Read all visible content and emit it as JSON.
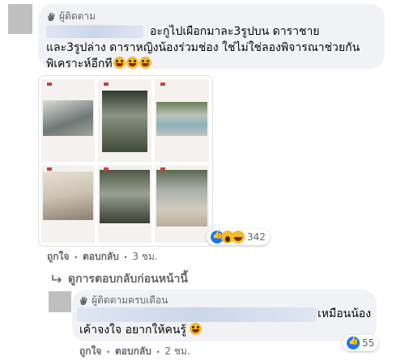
{
  "comment1": {
    "role_label": "ผู้ติดตาม",
    "text_line1": "อะกูไปเผือกมาละ3รูปบน ดาราชาย",
    "text_line2": "และ3รูปล่าง ดาราหญิงน้องร่วมช่อง ใช่ไม่ใช่ลองพิจารณาช่วยกัน",
    "text_line3": "พิเคราะห์อีกที",
    "reaction_count": "342",
    "like_label": "ถูกใจ",
    "reply_label": "ตอบกลับ",
    "time_label": "3 ชม."
  },
  "view_previous": {
    "label": "ดูการตอบกลับก่อนหน้านี้"
  },
  "comment2": {
    "role_label": "ผู้ติดตามครบเดือน",
    "text_line1": "เหมือนน้อง",
    "text_line2": "เค้าจงใจ อยากให้คนรู้",
    "reaction_count": "55",
    "like_label": "ถูกใจ",
    "reply_label": "ตอบกลับ",
    "time_label": "2 ชม."
  },
  "colors": {
    "bubble": "#f0f2f5",
    "meta_gray": "#65676b",
    "like_blue": "#1877f2",
    "emoji_yellow": "#f7b928"
  }
}
